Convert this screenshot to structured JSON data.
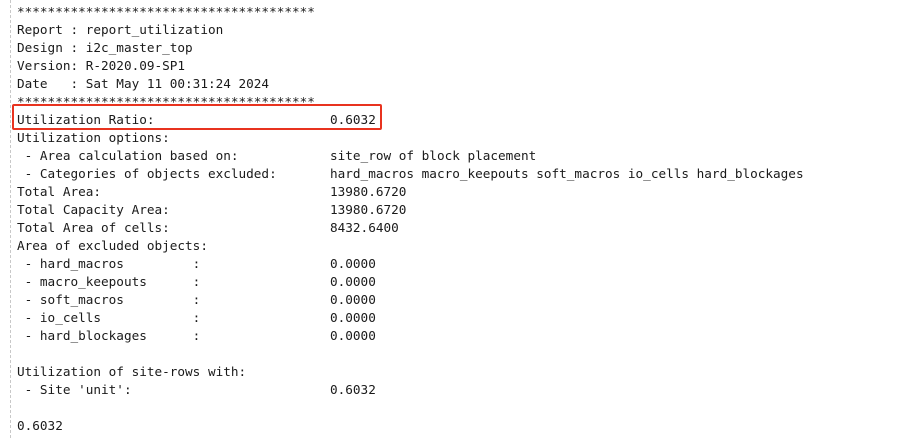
{
  "header": {
    "separator_top": "***************************************",
    "report": "Report : report_utilization",
    "design": "Design : i2c_master_top",
    "version": "Version: R-2020.09-SP1",
    "date": "Date   : Sat May 11 00:31:24 2024",
    "separator_bottom": "***************************************"
  },
  "utilization_ratio": {
    "label": "Utilization Ratio:",
    "value": "0.6032"
  },
  "options": {
    "title": "Utilization options:",
    "area_calc_label": " - Area calculation based on:",
    "area_calc_value": "site_row of block placement",
    "categories_label": " - Categories of objects excluded:",
    "categories_value": "hard_macros macro_keepouts soft_macros io_cells hard_blockages"
  },
  "totals": [
    {
      "label": "Total Area:",
      "value": "13980.6720"
    },
    {
      "label": "Total Capacity Area:",
      "value": "13980.6720"
    },
    {
      "label": "Total Area of cells:",
      "value": "8432.6400"
    }
  ],
  "excluded": {
    "title": "Area of excluded objects:",
    "items": [
      {
        "label": " - hard_macros         :",
        "value": "0.0000"
      },
      {
        "label": " - macro_keepouts      :",
        "value": "0.0000"
      },
      {
        "label": " - soft_macros         :",
        "value": "0.0000"
      },
      {
        "label": " - io_cells            :",
        "value": "0.0000"
      },
      {
        "label": " - hard_blockages      :",
        "value": "0.0000"
      }
    ]
  },
  "site_rows": {
    "title": "Utilization of site-rows with:",
    "label": " - Site 'unit':",
    "value": "0.6032"
  },
  "final_value": "0.6032",
  "accent_color": "#e8331f"
}
